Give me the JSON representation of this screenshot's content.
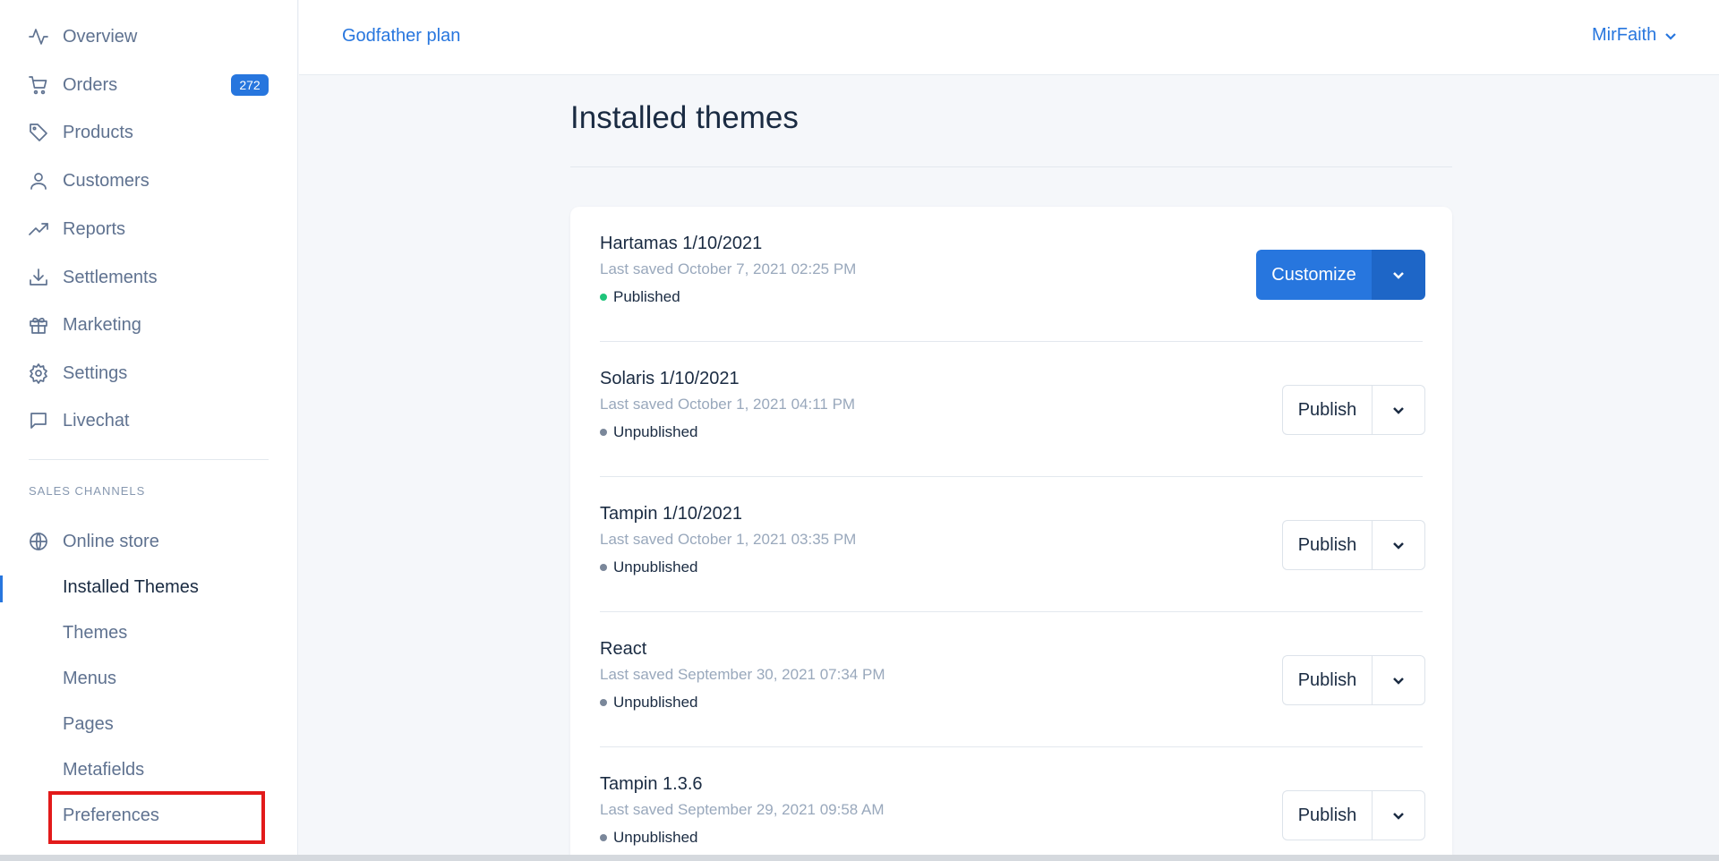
{
  "topbar": {
    "plan": "Godfather plan",
    "user": "MirFaith"
  },
  "sidebar": {
    "items": [
      {
        "label": "Overview",
        "icon": "activity-icon"
      },
      {
        "label": "Orders",
        "icon": "cart-icon",
        "badge": "272"
      },
      {
        "label": "Products",
        "icon": "tag-icon"
      },
      {
        "label": "Customers",
        "icon": "user-icon"
      },
      {
        "label": "Reports",
        "icon": "trending-up-icon"
      },
      {
        "label": "Settlements",
        "icon": "download-icon"
      },
      {
        "label": "Marketing",
        "icon": "gift-icon"
      },
      {
        "label": "Settings",
        "icon": "gear-icon"
      },
      {
        "label": "Livechat",
        "icon": "chat-icon"
      }
    ],
    "sales_channels_title": "SALES CHANNELS",
    "online_store": {
      "label": "Online store",
      "icon": "globe-icon"
    },
    "sub_items": [
      {
        "label": "Installed Themes",
        "active": true
      },
      {
        "label": "Themes"
      },
      {
        "label": "Menus"
      },
      {
        "label": "Pages"
      },
      {
        "label": "Metafields"
      },
      {
        "label": "Preferences"
      }
    ]
  },
  "main": {
    "title": "Installed themes",
    "themes": [
      {
        "name": "Hartamas 1/10/2021",
        "saved": "Last saved October 7, 2021 02:25 PM",
        "status": "Published",
        "action": "Customize"
      },
      {
        "name": "Solaris 1/10/2021",
        "saved": "Last saved October 1, 2021 04:11 PM",
        "status": "Unpublished",
        "action": "Publish"
      },
      {
        "name": "Tampin 1/10/2021",
        "saved": "Last saved October 1, 2021 03:35 PM",
        "status": "Unpublished",
        "action": "Publish"
      },
      {
        "name": "React",
        "saved": "Last saved September 30, 2021 07:34 PM",
        "status": "Unpublished",
        "action": "Publish"
      },
      {
        "name": "Tampin 1.3.6",
        "saved": "Last saved September 29, 2021 09:58 AM",
        "status": "Unpublished",
        "action": "Publish"
      }
    ]
  },
  "colors": {
    "accent": "#2776de",
    "published": "#1ec47a",
    "highlight": "#e21a1a"
  }
}
